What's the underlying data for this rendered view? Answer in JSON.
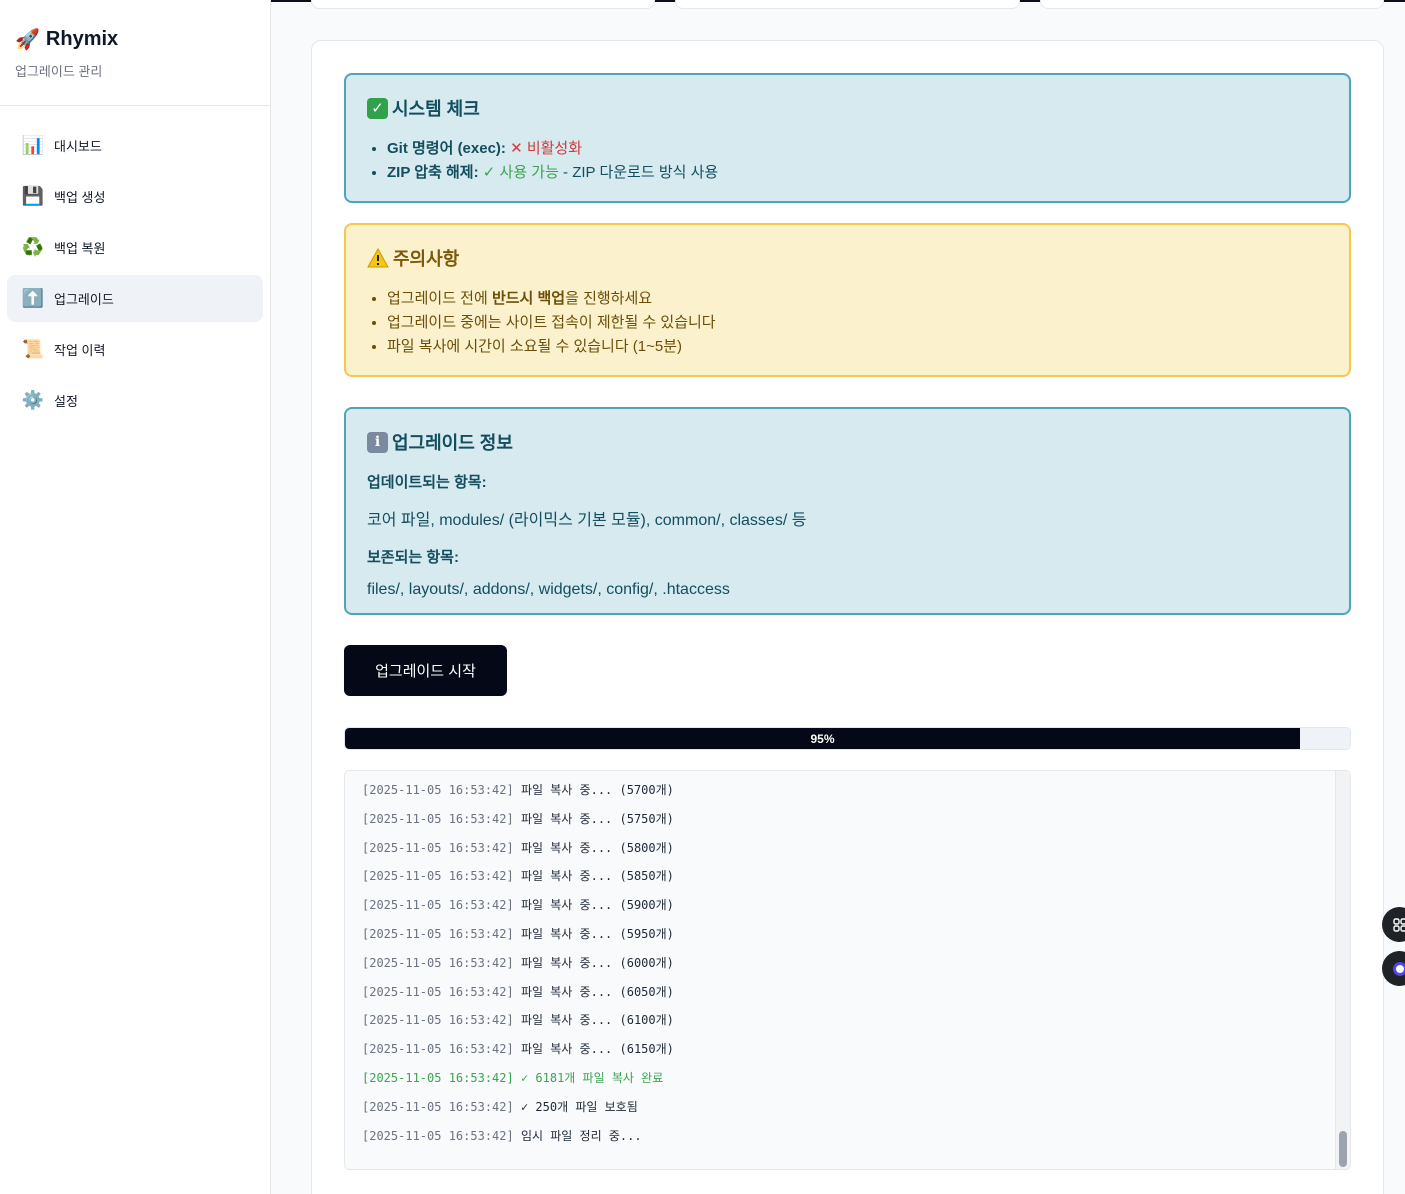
{
  "sidebar": {
    "brand_icon": "🚀",
    "brand_title": "Rhymix",
    "brand_subtitle": "업그레이드 관리",
    "items": [
      {
        "label": "대시보드",
        "icon": "📊"
      },
      {
        "label": "백업 생성",
        "icon": "💾"
      },
      {
        "label": "백업 복원",
        "icon": "♻️"
      },
      {
        "label": "업그레이드",
        "icon": "⬆️"
      },
      {
        "label": "작업 이력",
        "icon": "📜"
      },
      {
        "label": "설정",
        "icon": "⚙️"
      }
    ]
  },
  "system_check": {
    "title": "시스템 체크",
    "git_label": "Git 명령어 (exec):",
    "git_status": "✕ 비활성화",
    "zip_label": "ZIP 압축 해제:",
    "zip_status": "✓ 사용 가능",
    "zip_note": " - ZIP 다운로드 방식 사용"
  },
  "caution": {
    "title": "주의사항",
    "item1_pre": "업그레이드 전에 ",
    "item1_bold": "반드시 백업",
    "item1_post": "을 진행하세요",
    "item2": "업그레이드 중에는 사이트 접속이 제한될 수 있습니다",
    "item3": "파일 복사에 시간이 소요될 수 있습니다 (1~5분)"
  },
  "upgrade_info": {
    "title": "업그레이드 정보",
    "updated_heading": "업데이트되는 항목:",
    "updated_text": "코어 파일, modules/ (라이믹스 기본 모듈), common/, classes/ 등",
    "preserved_heading": "보존되는 항목:",
    "preserved_text": "files/, layouts/, addons/, widgets/, config/, .htaccess"
  },
  "start_button": "업그레이드 시작",
  "progress": {
    "value": 0.95,
    "label": "95%"
  },
  "log": [
    {
      "ts": "[2025-11-05 16:53:42]",
      "msg": " 파일 복사 중... (5700개)"
    },
    {
      "ts": "[2025-11-05 16:53:42]",
      "msg": " 파일 복사 중... (5750개)"
    },
    {
      "ts": "[2025-11-05 16:53:42]",
      "msg": " 파일 복사 중... (5800개)"
    },
    {
      "ts": "[2025-11-05 16:53:42]",
      "msg": " 파일 복사 중... (5850개)"
    },
    {
      "ts": "[2025-11-05 16:53:42]",
      "msg": " 파일 복사 중... (5900개)"
    },
    {
      "ts": "[2025-11-05 16:53:42]",
      "msg": " 파일 복사 중... (5950개)"
    },
    {
      "ts": "[2025-11-05 16:53:42]",
      "msg": " 파일 복사 중... (6000개)"
    },
    {
      "ts": "[2025-11-05 16:53:42]",
      "msg": " 파일 복사 중... (6050개)"
    },
    {
      "ts": "[2025-11-05 16:53:42]",
      "msg": " 파일 복사 중... (6100개)"
    },
    {
      "ts": "[2025-11-05 16:53:42]",
      "msg": " 파일 복사 중... (6150개)"
    },
    {
      "ts": "[2025-11-05 16:53:42]",
      "msg": " ✓ 6181개 파일 복사 완료",
      "type": "success"
    },
    {
      "ts": "[2025-11-05 16:53:42]",
      "msg": " ✓ 250개 파일 보호됨"
    },
    {
      "ts": "[2025-11-05 16:53:42]",
      "msg": " 임시 파일 정리 중..."
    }
  ],
  "colors": {
    "accent": "#050816",
    "info_border": "#4fa4b6",
    "warn_border": "#f5c84a",
    "success": "#3aa54f",
    "danger": "#d23b3b"
  }
}
